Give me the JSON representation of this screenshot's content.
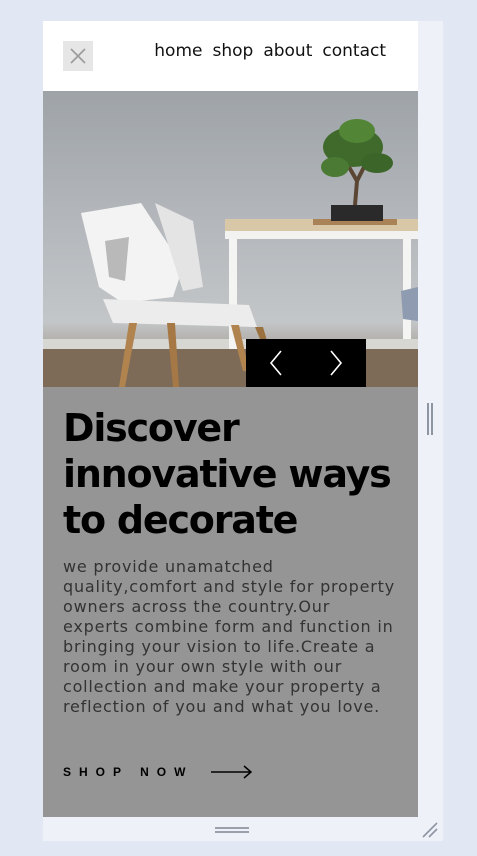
{
  "nav": {
    "close_icon": "close-icon",
    "links": [
      "home",
      "shop",
      "about",
      "contact"
    ]
  },
  "hero": {
    "image": "chair-and-bonsai-photo",
    "prev_icon": "chevron-left-icon",
    "next_icon": "chevron-right-icon"
  },
  "content": {
    "title_line1": "Discover",
    "title_line2": "innovative ways",
    "title_line3": "to decorate",
    "description": "we provide unamatched quality,comfort and style for property owners across the country.Our experts combine form and function in bringing your vision to life.Create a room in your own style with our collection and make your property a reflection of you and what you love.",
    "cta_label": "SHOP NOW",
    "cta_icon": "arrow-right-icon"
  },
  "colors": {
    "page_bg": "#e1e7f3",
    "content_bg": "#959595",
    "slider_bg": "#000000"
  }
}
